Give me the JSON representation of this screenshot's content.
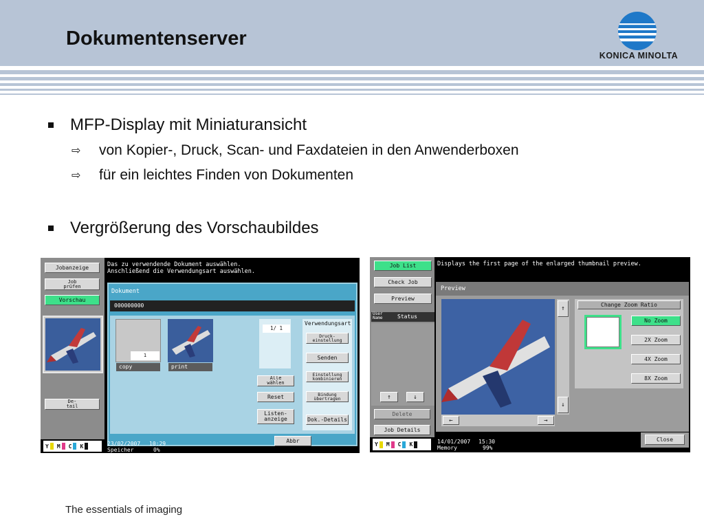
{
  "slide": {
    "title": "Dokumentenserver",
    "brand": "KONICA MINOLTA",
    "footer": "The essentials of imaging",
    "bullets": [
      {
        "text": "MFP-Display mit Miniaturansicht",
        "subs": [
          "von Kopier-, Druck, Scan- und Faxdateien in den Anwenderboxen",
          "für ein leichtes Finden von Dokumenten"
        ]
      },
      {
        "text": "Vergrößerung des Vorschaubildes",
        "subs": []
      }
    ]
  },
  "colors": {
    "header": "#b7c4d6",
    "panel_teal": "#4aa6c8",
    "button_selected": "#3ee08a",
    "logo_blue": "#1e78c8"
  },
  "screen_left": {
    "sidebar": [
      "Jobanzeige",
      "Job\nprüfen",
      "Vorschau"
    ],
    "selected_sidebar": "Vorschau",
    "detail_button": "De-\ntail",
    "message": "Das zu verwendende Dokument auswählen.\nAnschließend die Verwendungsart auswählen.",
    "panel_title": "Dokument",
    "box_number": "000000000",
    "thumbnails": [
      "copy",
      "print"
    ],
    "thumb_label": "1",
    "page_counter": "1/  1",
    "usage_header": "Verwendungsart",
    "usage_buttons": [
      "Druck-\neinstellung",
      "Senden",
      "Einstellung\nkombinieren",
      "Bindung\nübertragen",
      "Dok.-Details"
    ],
    "action_buttons": [
      "Alle\nwählen",
      "Reset",
      "Listen-\nanzeige"
    ],
    "abort": "Abbr",
    "date": "23/02/2007",
    "time": "10:29",
    "memory_label": "Speicher",
    "memory_value": "0%",
    "toner": [
      "Y",
      "M",
      "C",
      "K"
    ]
  },
  "screen_right": {
    "sidebar": [
      "Job List",
      "Check Job",
      "Preview"
    ],
    "selected_sidebar": "Job List",
    "list_headers": [
      "User\nName",
      "Status"
    ],
    "message": "Displays the first page of the enlarged thumbnail preview.",
    "panel_title": "Preview",
    "zoom_title": "Change Zoom Ratio",
    "zoom_options": [
      "No Zoom",
      "2X Zoom",
      "4X Zoom",
      "8X Zoom"
    ],
    "selected_zoom": "No Zoom",
    "delete": "Delete",
    "job_details": "Job Details",
    "close": "Close",
    "date": "14/01/2007",
    "time": "15:30",
    "memory_label": "Memory",
    "memory_value": "99%",
    "toner": [
      "Y",
      "M",
      "C",
      "K"
    ]
  }
}
